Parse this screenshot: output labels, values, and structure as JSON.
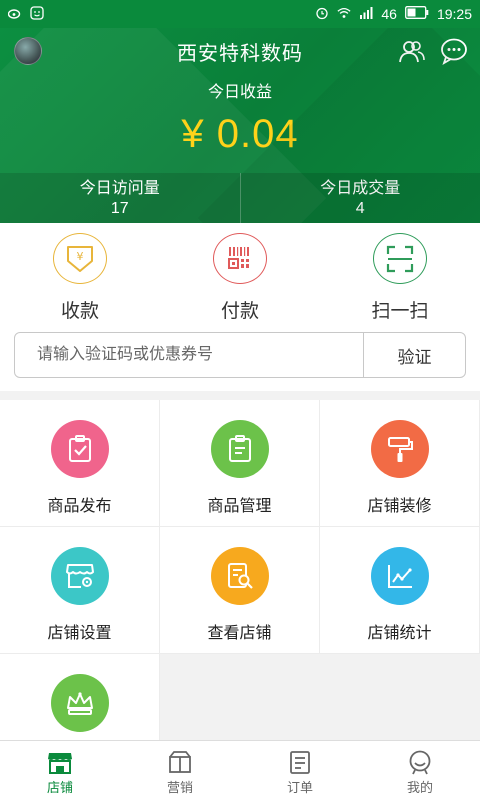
{
  "status_bar": {
    "signal": "46",
    "time": "19:25"
  },
  "header": {
    "title": "西安特科数码",
    "income_label": "今日收益",
    "income_value": "¥ 0.04",
    "stats": [
      {
        "label": "今日访问量",
        "value": "17"
      },
      {
        "label": "今日成交量",
        "value": "4"
      }
    ]
  },
  "quick_actions": [
    {
      "label": "收款",
      "icon": "yen-download-icon",
      "color": "#e8b53a"
    },
    {
      "label": "付款",
      "icon": "barcode-icon",
      "color": "#e05a5a"
    },
    {
      "label": "扫一扫",
      "icon": "scan-icon",
      "color": "#2f9c5a"
    }
  ],
  "verify": {
    "placeholder": "请输入验证码或优惠券号",
    "button": "验证"
  },
  "grid": [
    {
      "label": "商品发布",
      "icon": "clipboard-check-icon",
      "color": "#f0648c"
    },
    {
      "label": "商品管理",
      "icon": "clipboard-list-icon",
      "color": "#6cc24a"
    },
    {
      "label": "店铺装修",
      "icon": "paint-roller-icon",
      "color": "#f26b45"
    },
    {
      "label": "店铺设置",
      "icon": "store-settings-icon",
      "color": "#3cc7c7"
    },
    {
      "label": "查看店铺",
      "icon": "document-search-icon",
      "color": "#f7a91e"
    },
    {
      "label": "店铺统计",
      "icon": "line-chart-icon",
      "color": "#33b7e8"
    },
    {
      "label": "",
      "icon": "crown-icon",
      "color": "#6cc24a"
    }
  ],
  "tabs": [
    {
      "label": "店铺",
      "icon": "shop-icon",
      "active": true
    },
    {
      "label": "营销",
      "icon": "marketing-icon",
      "active": false
    },
    {
      "label": "订单",
      "icon": "order-icon",
      "active": false
    },
    {
      "label": "我的",
      "icon": "profile-icon",
      "active": false
    }
  ],
  "colors": {
    "brand": "#0a8a3c",
    "income": "#ffd21a"
  }
}
